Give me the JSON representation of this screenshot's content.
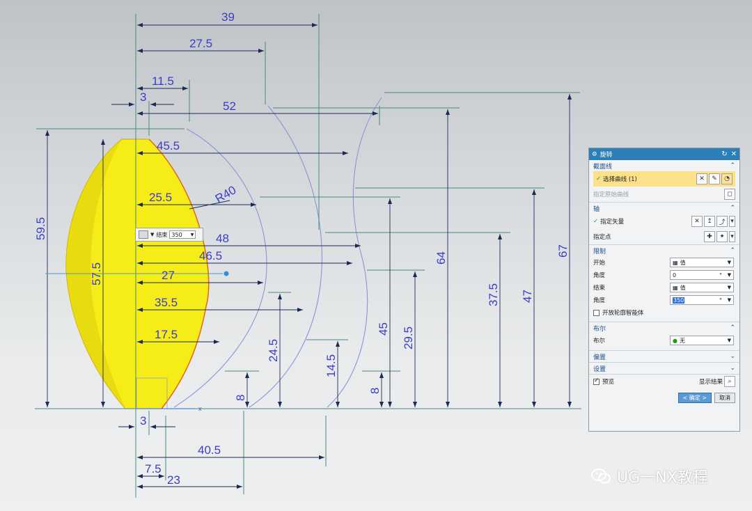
{
  "canvas": {
    "dims_horizontal": [
      "39",
      "27.5",
      "11.5",
      "3",
      "52",
      "45.5",
      "25.5",
      "48",
      "46.5",
      "27",
      "35.5",
      "17.5",
      "3",
      "40.5",
      "7.5",
      "23"
    ],
    "dims_vertical": [
      "59.5",
      "57.5",
      "64",
      "67",
      "37.5",
      "47",
      "45",
      "29.5",
      "24.5",
      "14.5",
      "8",
      "8"
    ],
    "radius_label": "R40",
    "axis_label": "x",
    "solid_color": "#f5ec18"
  },
  "float_bar": {
    "label": "结束",
    "value": "350"
  },
  "dialog": {
    "title": "旋转",
    "sections": {
      "section_curve": "截面线",
      "section_axis": "轴",
      "section_limits": "限制",
      "section_bool": "布尔",
      "section_offset": "偏置",
      "section_settings": "设置"
    },
    "select_curve": "选择曲线 (1)",
    "origin_curve": "指定原始曲线",
    "specify_vector": "指定矢量",
    "specify_point": "指定点",
    "start_label": "开始",
    "start_value": "值",
    "start_angle_label": "角度",
    "start_angle": "0",
    "end_label": "结束",
    "end_value": "值",
    "end_angle_label": "角度",
    "end_angle": "350",
    "angle_unit": "°",
    "open_profile": "开放轮廓智能体",
    "bool_label": "布尔",
    "bool_value": "无",
    "preview_label": "预览",
    "show_result": "显示结果",
    "ok": "< 确定 >",
    "cancel": "取消"
  },
  "watermark": {
    "text": "UG一NX教程"
  }
}
